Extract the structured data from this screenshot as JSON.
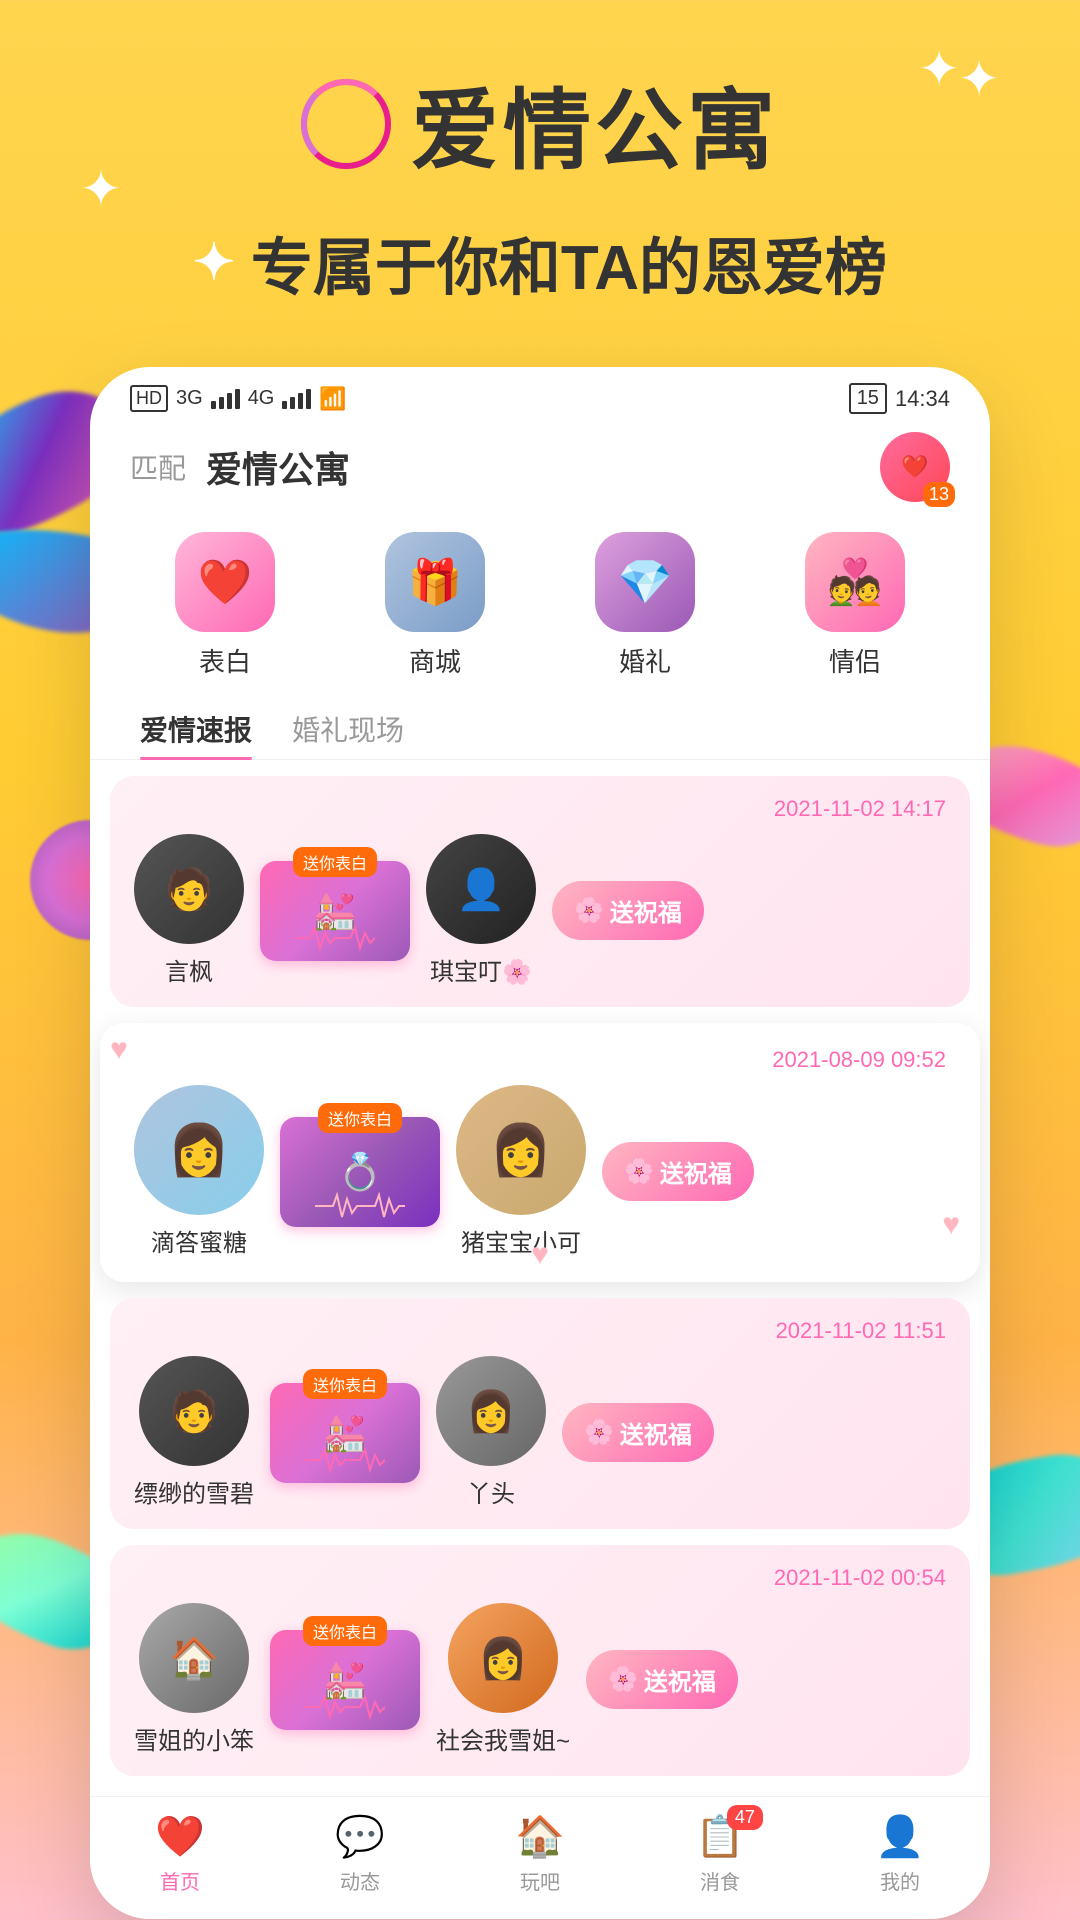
{
  "app": {
    "title": "爱情公寓",
    "subtitle": "专属于你和TA的恩爱榜",
    "logo_text": "○"
  },
  "status_bar": {
    "left": "HD 2  3G  4G  WiFi",
    "time": "14:34",
    "battery": "15"
  },
  "header": {
    "match_label": "匹配",
    "title": "爱情公寓",
    "badge_num": "13"
  },
  "menu": [
    {
      "icon": "❤️",
      "label": "表白",
      "color": "pink"
    },
    {
      "icon": "🎁",
      "label": "商城",
      "color": "blue"
    },
    {
      "icon": "💎",
      "label": "婚礼",
      "color": "purple"
    },
    {
      "icon": "💑",
      "label": "情侣",
      "color": "rose"
    }
  ],
  "tabs": [
    {
      "label": "爱情速报",
      "active": true
    },
    {
      "label": "婚礼现场",
      "active": false
    }
  ],
  "cards": [
    {
      "time": "2021-11-02 14:17",
      "user1": "言枫",
      "user2": "琪宝叮🌸",
      "user1_avatar": "dark",
      "user2_avatar": "dark2",
      "send_btn": "送祝福",
      "stage_label": "送你表白"
    },
    {
      "time": "2021-08-09 09:52",
      "user1": "滴答蜜糖",
      "user2": "猪宝宝小可",
      "user1_avatar": "girl",
      "user2_avatar": "girl2",
      "send_btn": "送祝福",
      "stage_label": "送你表白",
      "expanded": true
    },
    {
      "time": "2021-11-02 11:51",
      "user1": "缥缈的雪碧",
      "user2": "丫头",
      "user1_avatar": "boy",
      "user2_avatar": "girl3",
      "send_btn": "送祝福",
      "stage_label": "送你表白"
    },
    {
      "time": "2021-11-02 00:54",
      "user1": "雪姐的小笨",
      "user2": "社会我雪姐~",
      "user1_avatar": "room",
      "user2_avatar": "fashion",
      "send_btn": "送祝福",
      "stage_label": "送你表白"
    }
  ],
  "bottom_nav": [
    {
      "icon": "❤️",
      "label": "首页",
      "active": true
    },
    {
      "icon": "💬",
      "label": "动态",
      "active": false
    },
    {
      "icon": "🏠",
      "label": "玩吧",
      "active": false
    },
    {
      "icon": "📋",
      "label": "消食",
      "active": false,
      "badge": "47"
    },
    {
      "icon": "👤",
      "label": "我的",
      "active": false
    }
  ]
}
